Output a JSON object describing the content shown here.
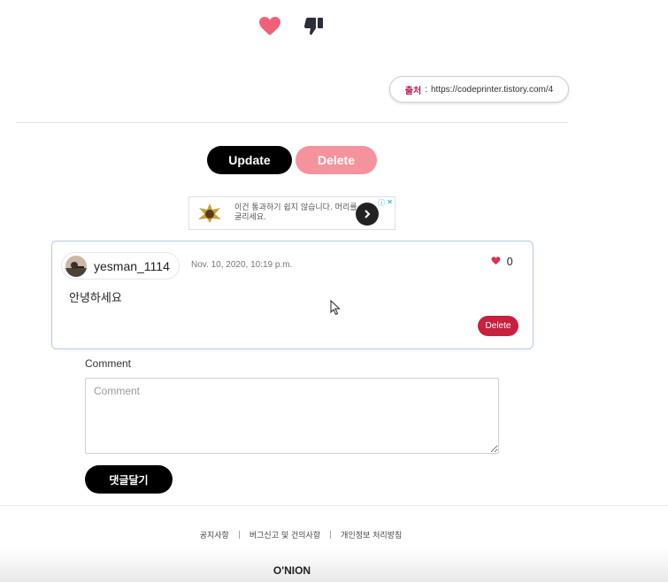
{
  "reactions": {
    "like_icon": "heart-icon",
    "dislike_icon": "thumbs-down-icon",
    "like_color": "#f06079",
    "dislike_color": "#2b2f3a"
  },
  "source": {
    "label": "출처",
    "separator": ":",
    "url": "https://codeprinter.tistory.com/4"
  },
  "post_actions": {
    "update_label": "Update",
    "delete_label": "Delete"
  },
  "ad": {
    "text": "이건 통과하기 쉽지 않습니다. 머리를 굴리세요.",
    "arrow_icon": "chevron-right-icon",
    "info_icon": "info-icon",
    "close_icon": "close-icon"
  },
  "comment": {
    "username": "yesman_1114",
    "date": "Nov. 10, 2020, 10:19 p.m.",
    "likes": "0",
    "body": "안녕하세요",
    "delete_label": "Delete"
  },
  "comment_form": {
    "label": "Comment",
    "placeholder": "Comment",
    "submit_label": "댓글달기"
  },
  "footer": {
    "links": [
      "공지사항",
      "버그신고 및 건의사항",
      "개인정보 처리방침"
    ],
    "separator": "|",
    "brand": "O'NION"
  },
  "colors": {
    "accent_pink": "#f5939d",
    "danger_red": "#c8203f",
    "card_border": "#b7c7e6"
  }
}
